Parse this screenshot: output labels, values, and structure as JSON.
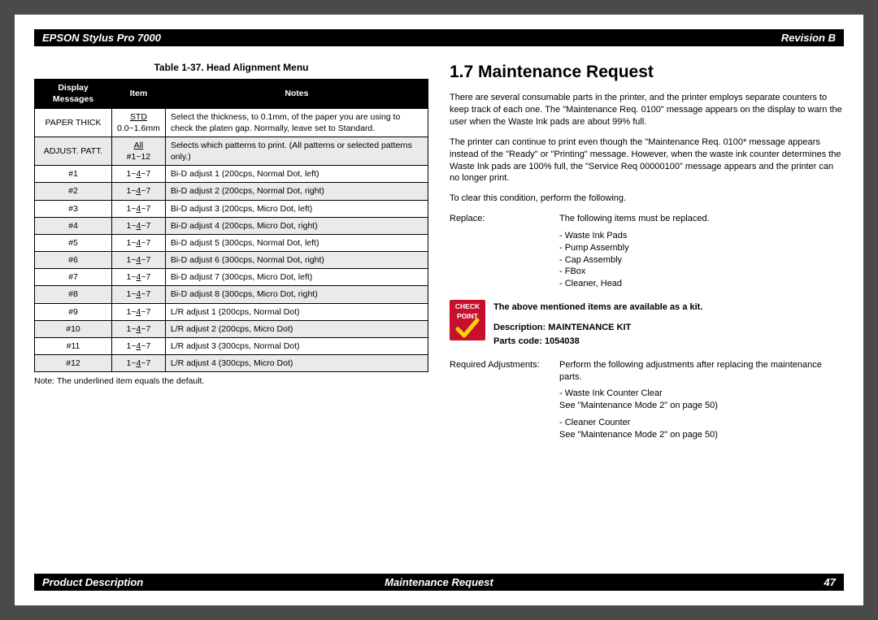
{
  "header": {
    "left": "EPSON Stylus Pro 7000",
    "right": "Revision B"
  },
  "footer": {
    "left": "Product Description",
    "center": "Maintenance Request",
    "right": "47"
  },
  "left_col": {
    "table_title": "Table 1-37.  Head Alignment Menu",
    "headers": [
      "Display Messages",
      "Item",
      "Notes"
    ],
    "rows": [
      {
        "c1": "PAPER THICK",
        "c2_u": "STD",
        "c2_b": "0.0~1.6mm",
        "c3": "Select the thickness, to 0.1mm, of the paper you are using to check the platen gap. Normally, leave set to Standard."
      },
      {
        "c1": "ADJUST. PATT.",
        "c2_u": "All",
        "c2_b": "#1~12",
        "c3": "Selects which patterns to print. (All patterns or selected patterns only.)"
      },
      {
        "c1": "#1",
        "c2": "1~4~7",
        "c3": "Bi-D adjust 1 (200cps, Normal Dot, left)"
      },
      {
        "c1": "#2",
        "c2": "1~4~7",
        "c3": "Bi-D adjust 2 (200cps, Normal Dot, right)"
      },
      {
        "c1": "#3",
        "c2": "1~4~7",
        "c3": "Bi-D adjust 3 (200cps, Micro Dot, left)"
      },
      {
        "c1": "#4",
        "c2": "1~4~7",
        "c3": "Bi-D adjust 4 (200cps, Micro Dot, right)"
      },
      {
        "c1": "#5",
        "c2": "1~4~7",
        "c3": "Bi-D adjust 5 (300cps, Normal Dot, left)"
      },
      {
        "c1": "#6",
        "c2": "1~4~7",
        "c3": "Bi-D adjust 6 (300cps, Normal Dot, right)"
      },
      {
        "c1": "#7",
        "c2": "1~4~7",
        "c3": "Bi-D adjust 7 (300cps, Micro Dot, left)"
      },
      {
        "c1": "#8",
        "c2": "1~4~7",
        "c3": "Bi-D adjust 8 (300cps, Micro Dot, right)"
      },
      {
        "c1": "#9",
        "c2": "1~4~7",
        "c3": "L/R adjust 1 (200cps, Normal Dot)"
      },
      {
        "c1": "#10",
        "c2": "1~4~7",
        "c3": "L/R adjust 2 (200cps, Micro Dot)"
      },
      {
        "c1": "#11",
        "c2": "1~4~7",
        "c3": "L/R adjust 3 (300cps, Normal Dot)"
      },
      {
        "c1": "#12",
        "c2": "1~4~7",
        "c3": "L/R adjust 4 (300cps, Micro Dot)"
      }
    ],
    "note": "Note: The underlined item equals the default."
  },
  "right_col": {
    "heading": "1.7  Maintenance Request",
    "p1": "There are several consumable parts in the printer, and the printer employs separate counters to keep track of each one. The \"Maintenance Req. 0100\" message appears on the display to warn the user when the Waste Ink pads are about 99% full.",
    "p2": "The printer can continue to print even though the \"Maintenance Req. 0100* message appears instead of the \"Ready\" or \"Printing\" message. However, when the waste ink counter determines the Waste Ink pads are 100% full, the \"Service Req 00000100\" message appears and the printer can no longer print.",
    "p3": "To clear this condition, perform the following.",
    "replace_label": "Replace:",
    "replace_intro": "The following items must be replaced.",
    "replace_items": [
      "- Waste Ink Pads",
      "- Pump Assembly",
      "- Cap Assembly",
      "- FBox",
      "- Cleaner, Head"
    ],
    "checkpoint": {
      "label1": "CHECK",
      "label2": "POINT",
      "line1": "The above mentioned items are available as a kit.",
      "line2": "Description: MAINTENANCE KIT",
      "line3": "Parts code: 1054038"
    },
    "adj_label": "Required Adjustments:",
    "adj_intro": "Perform the following adjustments after replacing the maintenance parts.",
    "adj_items": [
      "- Waste Ink Counter Clear",
      "See \"Maintenance Mode 2\" on page 50)",
      "",
      "- Cleaner Counter",
      "See \"Maintenance Mode 2\" on page 50)"
    ]
  }
}
